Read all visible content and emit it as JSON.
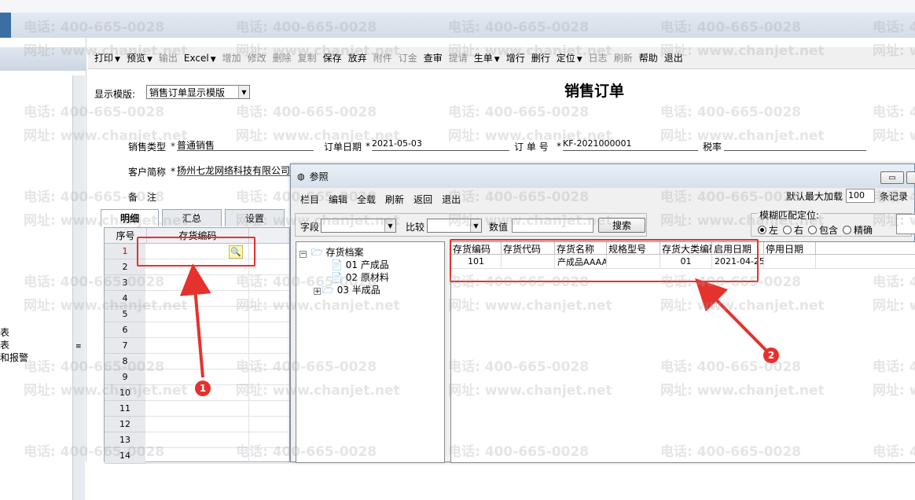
{
  "toolbar": {
    "items": [
      {
        "label": "打印",
        "dd": true,
        "enabled": true
      },
      {
        "label": "预览",
        "dd": true,
        "enabled": true
      },
      {
        "label": "输出",
        "dd": false,
        "enabled": false
      },
      {
        "label": "Excel",
        "dd": true,
        "enabled": true
      },
      {
        "label": "增加",
        "dd": false,
        "enabled": false
      },
      {
        "label": "修改",
        "dd": false,
        "enabled": false
      },
      {
        "label": "删除",
        "dd": false,
        "enabled": false
      },
      {
        "label": "复制",
        "dd": false,
        "enabled": false
      },
      {
        "label": "保存",
        "dd": false,
        "enabled": true
      },
      {
        "label": "放弃",
        "dd": false,
        "enabled": true
      },
      {
        "label": "附件",
        "dd": false,
        "enabled": false
      },
      {
        "label": "订金",
        "dd": false,
        "enabled": false
      },
      {
        "label": "查审",
        "dd": false,
        "enabled": true
      },
      {
        "label": "提请",
        "dd": false,
        "enabled": false
      },
      {
        "label": "生单",
        "dd": true,
        "enabled": true
      },
      {
        "label": "增行",
        "dd": false,
        "enabled": true
      },
      {
        "label": "删行",
        "dd": false,
        "enabled": true
      },
      {
        "label": "定位",
        "dd": true,
        "enabled": true
      },
      {
        "label": "日志",
        "dd": false,
        "enabled": false
      },
      {
        "label": "刷新",
        "dd": false,
        "enabled": false
      },
      {
        "label": "帮助",
        "dd": false,
        "enabled": true
      },
      {
        "label": "退出",
        "dd": false,
        "enabled": true
      }
    ]
  },
  "leftpanel": {
    "items": [
      "表",
      "表",
      "和报警"
    ]
  },
  "form": {
    "template_label": "显示模版:",
    "template_value": "销售订单显示模版",
    "title": "销售订单",
    "sale_type_label": "销售类型",
    "sale_type_value": "普通销售",
    "order_date_label": "订单日期",
    "order_date_value": "2021-05-03",
    "order_no_label": "订 单 号",
    "order_no_value": "KF-2021000001",
    "tax_label": "税率",
    "customer_label": "客户简称",
    "customer_value": "扬州七龙网络科技有限公司",
    "remark_label": "备　注",
    "required_mark": "*"
  },
  "tabs": [
    "明细",
    "汇总",
    "设置"
  ],
  "grid": {
    "col_seq": "序号",
    "col_code": "存货编码",
    "rows": [
      "1",
      "2",
      "3",
      "4",
      "5",
      "6",
      "7",
      "8",
      "9",
      "10",
      "11",
      "12",
      "13",
      "14"
    ]
  },
  "dialog": {
    "title": "参照",
    "menu": [
      "栏目",
      "编辑",
      "全载",
      "刷新",
      "返回",
      "退出"
    ],
    "max_load_label": "默认最大加载",
    "max_load_value": "100",
    "records_label": "条记录",
    "field_label": "字段",
    "compare_label": "比较",
    "value_label": "数值",
    "search_button": "搜索",
    "fuzzy_label": "模糊匹配定位:",
    "radios": [
      "左",
      "右",
      "包含",
      "精确"
    ],
    "tree": {
      "root": "存货档案",
      "children": [
        "01 产成品",
        "02 原材料",
        "03 半成品"
      ]
    },
    "list_headers": [
      "存货编码",
      "存货代码",
      "存货名称",
      "规格型号",
      "存货大类编码",
      "启用日期",
      "停用日期"
    ],
    "list_rows": [
      [
        "101",
        "",
        "产成品AAAA",
        "",
        "01",
        "2021-04-25",
        ""
      ]
    ]
  },
  "annotations": [
    "1",
    "2"
  ],
  "watermark": {
    "phone": "电话: 400-665-0028",
    "site": "网址: www.chanjet.net"
  },
  "colors": {
    "highlight": "#e5322d",
    "required_row": "#cc0000"
  },
  "icons": {
    "search": "magnifier-icon",
    "folder": "folder-icon",
    "doc": "document-icon"
  }
}
